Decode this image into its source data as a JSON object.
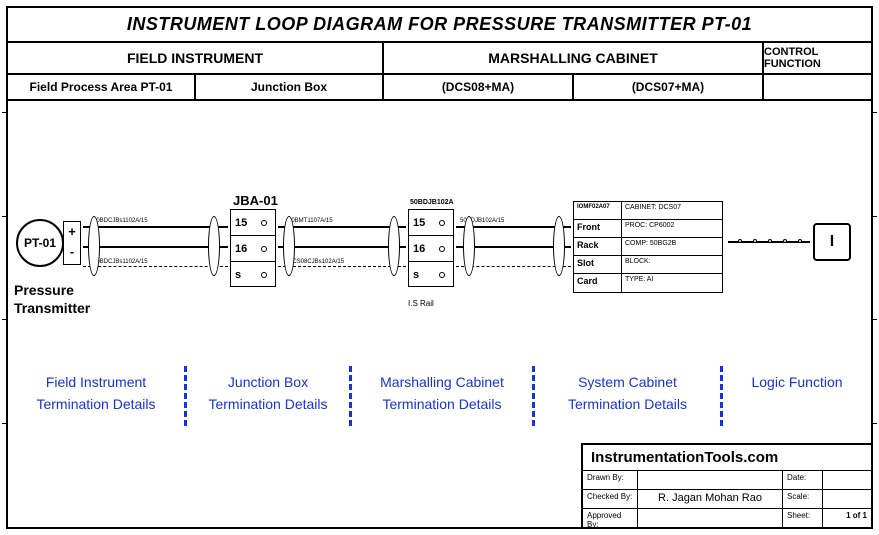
{
  "title": "INSTRUMENT LOOP DIAGRAM FOR PRESSURE TRANSMITTER PT-01",
  "columns": {
    "field_instrument": "FIELD INSTRUMENT",
    "marshalling_cabinet": "MARSHALLING CABINET",
    "control_function": "CONTROL FUNCTION"
  },
  "subcolumns": {
    "field_area": "Field Process Area PT-01",
    "junction_box": "Junction Box",
    "dcs08": "(DCS08+MA)",
    "dcs07": "(DCS07+MA)"
  },
  "transmitter": {
    "tag": "PT-01",
    "plus": "+",
    "minus": "-",
    "label_line1": "Pressure",
    "label_line2": "Transmitter"
  },
  "junction_box_box": {
    "label": "JBA-01",
    "rows": [
      "15",
      "16",
      "s"
    ]
  },
  "marshalling_box": {
    "label": "50BDJB102A",
    "rows": [
      "15",
      "16",
      "s"
    ]
  },
  "rail_text": "I.S Rail",
  "system_cabinet": {
    "rows": [
      {
        "left": "IOMF02A07",
        "right": "CABINET: DCS07"
      },
      {
        "left": "Front",
        "right": "PROC: CP6002"
      },
      {
        "left": "Rack",
        "right": "COMP: 50BG2B"
      },
      {
        "left": "Slot",
        "right": "BLOCK:"
      },
      {
        "left": "Card",
        "right": "TYPE: AI"
      }
    ]
  },
  "logic": {
    "symbol": "I"
  },
  "captions": {
    "field": "Field Instrument Termination Details",
    "jbox": "Junction Box Termination Details",
    "marshall": "Marshalling Cabinet Termination Details",
    "syscab": "System Cabinet Termination Details",
    "logic": "Logic Function"
  },
  "titleblock": {
    "brand": "InstrumentationTools.com",
    "drawn_by_label": "Drawn By:",
    "date_label": "Date:",
    "checked_by_label": "Checked By:",
    "checked_by": "R. Jagan Mohan Rao",
    "scale_label": "Scale:",
    "approved_by_label": "Approved By:",
    "sheet_label": "Sheet:",
    "sheet": "1 of 1"
  }
}
